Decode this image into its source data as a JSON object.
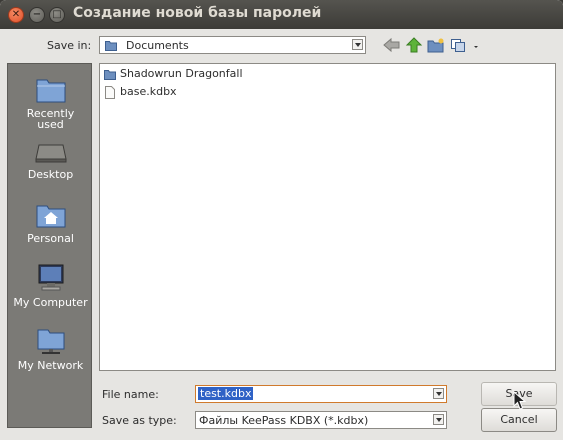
{
  "window": {
    "title": "Создание новой базы паролей",
    "close_glyph": "✕",
    "min_glyph": "−",
    "max_glyph": "□"
  },
  "toolbar": {
    "save_in_label": "Save in:",
    "location": "Documents",
    "icons": [
      "back-arrow-icon",
      "up-folder-icon",
      "new-folder-icon",
      "view-menu-icon"
    ]
  },
  "sidebar": {
    "items": [
      {
        "label_line1": "Recently",
        "label_line2": "used",
        "icon": "recent-folder-icon"
      },
      {
        "label_line1": "Desktop",
        "icon": "desktop-icon"
      },
      {
        "label_line1": "Personal",
        "icon": "home-folder-icon"
      },
      {
        "label_line1": "My Computer",
        "icon": "computer-icon"
      },
      {
        "label_line1": "My Network",
        "icon": "network-icon"
      }
    ]
  },
  "files": [
    {
      "name": "Shadowrun Dragonfall",
      "type": "folder"
    },
    {
      "name": "base.kdbx",
      "type": "file"
    }
  ],
  "form": {
    "file_name_label": "File name:",
    "file_name_value": "test.kdbx",
    "save_type_label": "Save as type:",
    "save_type_value": "Файлы KeePass KDBX (*.kdbx)",
    "save_button": "Save",
    "cancel_button": "Cancel"
  },
  "colors": {
    "titlebar": "#3c3b37",
    "selection": "#2f62c6",
    "sidebar": "#7b7a76"
  }
}
